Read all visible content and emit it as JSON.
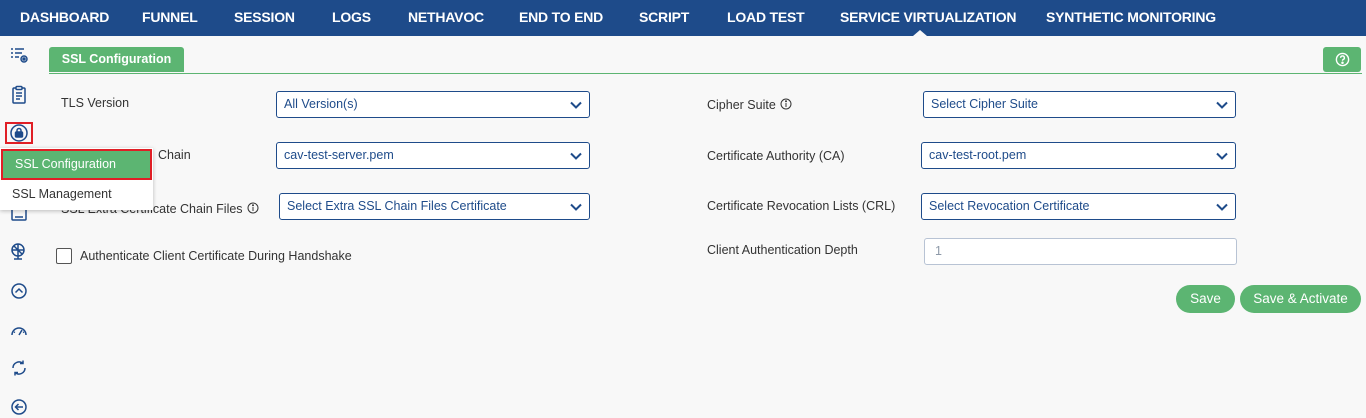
{
  "nav": {
    "items": [
      {
        "label": "DASHBOARD"
      },
      {
        "label": "FUNNEL"
      },
      {
        "label": "SESSION"
      },
      {
        "label": "LOGS"
      },
      {
        "label": "NETHAVOC"
      },
      {
        "label": "END TO END"
      },
      {
        "label": "SCRIPT"
      },
      {
        "label": "LOAD TEST"
      },
      {
        "label": "SERVICE VIRTUALIZATION"
      },
      {
        "label": "SYNTHETIC MONITORING"
      }
    ],
    "active": "SERVICE VIRTUALIZATION"
  },
  "sidebar": {
    "icons": [
      "list-settings-icon",
      "clipboard-icon",
      "lock-icon",
      "terminal-icon",
      "satellite-icon",
      "chevron-up-circle-icon",
      "speedometer-icon",
      "sync-icon",
      "arrow-left-circle-icon"
    ]
  },
  "flyout": {
    "items": [
      {
        "label": "SSL Configuration"
      },
      {
        "label": "SSL Management"
      }
    ]
  },
  "tab": {
    "label": "SSL Configuration"
  },
  "form": {
    "tls_version": {
      "label": "TLS Version",
      "value": "All Version(s)"
    },
    "cert_chain": {
      "label": "Chain",
      "value": "cav-test-server.pem"
    },
    "extra_chain": {
      "label": "SSL Extra Certificate Chain Files",
      "value": "Select Extra SSL Chain Files Certificate"
    },
    "auth_client": {
      "label": "Authenticate Client Certificate During Handshake"
    },
    "cipher_suite": {
      "label": "Cipher Suite",
      "value": "Select Cipher Suite"
    },
    "ca": {
      "label": "Certificate Authority (CA)",
      "value": "cav-test-root.pem"
    },
    "crl": {
      "label": "Certificate Revocation Lists (CRL)",
      "value": "Select Revocation Certificate"
    },
    "auth_depth": {
      "label": "Client Authentication Depth",
      "placeholder": "1"
    }
  },
  "buttons": {
    "save": "Save",
    "save_activate": "Save & Activate"
  },
  "colors": {
    "nav_bg": "#1e4b8a",
    "accent_green": "#5cb572",
    "highlight_red": "#e01f26"
  }
}
